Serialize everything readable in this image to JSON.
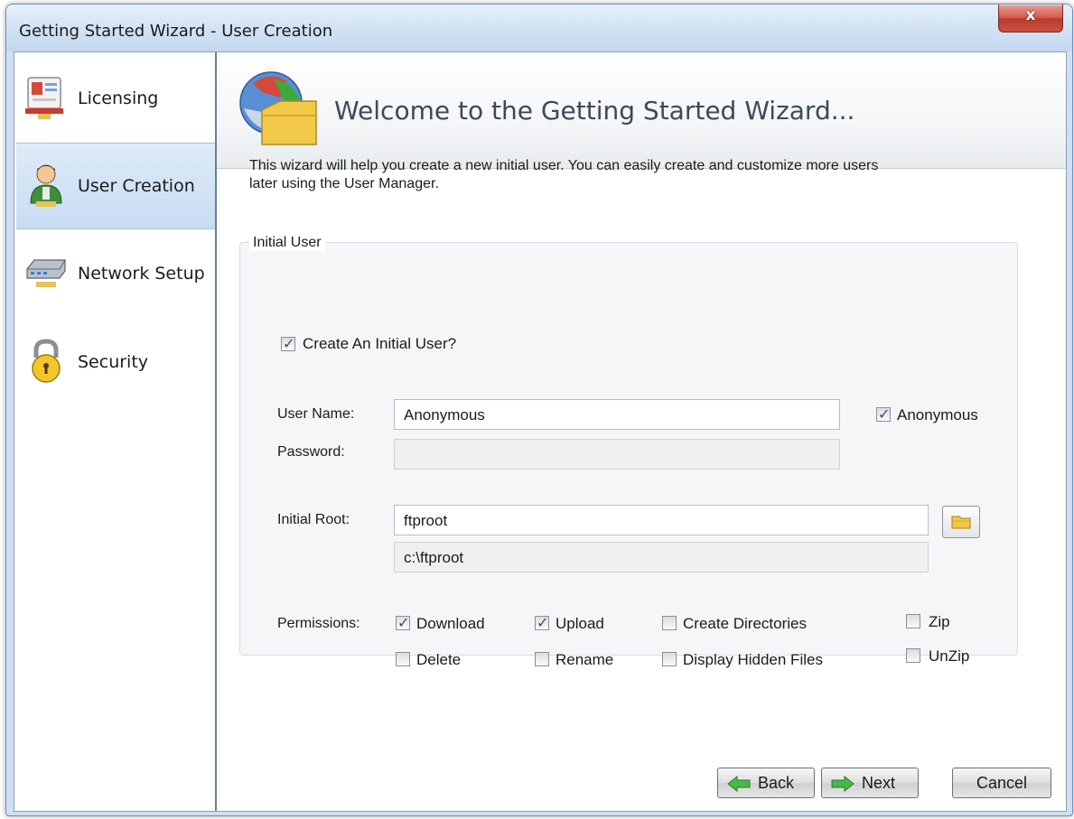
{
  "window": {
    "title": "Getting Started Wizard - User Creation",
    "close_label": "x"
  },
  "sidebar": {
    "items": [
      {
        "label": "Licensing",
        "icon": "license-certificate-icon",
        "active": false
      },
      {
        "label": "User Creation",
        "icon": "user-icon",
        "active": true
      },
      {
        "label": "Network Setup",
        "icon": "network-device-icon",
        "active": false
      },
      {
        "label": "Security",
        "icon": "padlock-icon",
        "active": false
      }
    ]
  },
  "header": {
    "title": "Welcome to the Getting Started Wizard..."
  },
  "intro": {
    "line1": "This wizard will help you create a new initial user.  You can easily create and customize more users",
    "line2": "later using the User Manager."
  },
  "group": {
    "title": "Initial User",
    "create_user": {
      "label": "Create An Initial User?",
      "checked": true
    },
    "username": {
      "label": "User Name:",
      "value": "Anonymous"
    },
    "anonymous": {
      "label": "Anonymous",
      "checked": true
    },
    "password": {
      "label": "Password:",
      "value": ""
    },
    "root": {
      "label": "Initial Root:",
      "value": "ftproot",
      "path": "c:\\ftproot"
    },
    "permissions": {
      "label": "Permissions:",
      "items": [
        {
          "label": "Download",
          "checked": true
        },
        {
          "label": "Upload",
          "checked": true
        },
        {
          "label": "Create Directories",
          "checked": false
        },
        {
          "label": "Zip",
          "checked": false
        },
        {
          "label": "Delete",
          "checked": false
        },
        {
          "label": "Rename",
          "checked": false
        },
        {
          "label": "Display Hidden Files",
          "checked": false
        },
        {
          "label": "UnZip",
          "checked": false
        }
      ]
    }
  },
  "buttons": {
    "back": "Back",
    "next": "Next",
    "cancel": "Cancel"
  },
  "colors": {
    "accent": "#c8dcf2",
    "arrow_green": "#3caa3c"
  }
}
